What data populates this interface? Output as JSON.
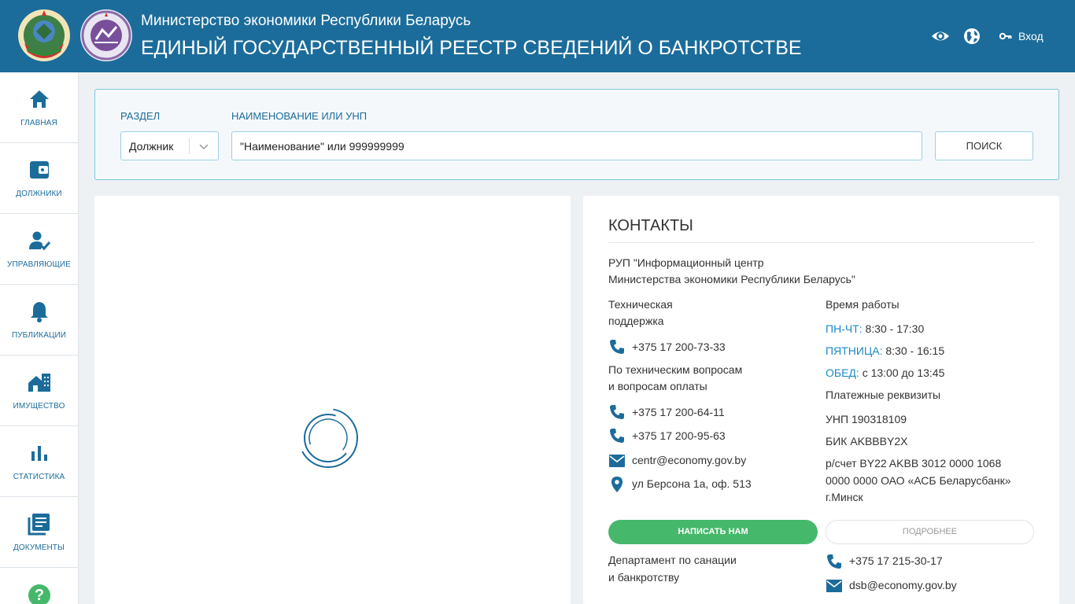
{
  "header": {
    "ministry": "Министерство экономики Республики Беларусь",
    "title": "ЕДИНЫЙ ГОСУДАРСТВЕННЫЙ РЕЕСТР СВЕДЕНИЙ О БАНКРОТСТВЕ",
    "login": "Вход"
  },
  "sidebar": {
    "items": [
      {
        "label": "ГЛАВНАЯ",
        "icon": "home-icon"
      },
      {
        "label": "ДОЛЖНИКИ",
        "icon": "wallet-icon"
      },
      {
        "label": "УПРАВЛЯЮЩИЕ",
        "icon": "user-check-icon"
      },
      {
        "label": "ПУБЛИКАЦИИ",
        "icon": "bell-icon"
      },
      {
        "label": "ИМУЩЕСТВО",
        "icon": "property-icon"
      },
      {
        "label": "СТАТИСТИКА",
        "icon": "bar-chart-icon"
      },
      {
        "label": "ДОКУМЕНТЫ",
        "icon": "documents-icon"
      }
    ],
    "help": "?"
  },
  "search": {
    "section_label": "РАЗДЕЛ",
    "section_value": "Должник",
    "name_label": "НАИМЕНОВАНИЕ ИЛИ УНП",
    "placeholder": "\"Наименование\" или 999999999",
    "button": "ПОИСК"
  },
  "contacts": {
    "title": "КОНТАКТЫ",
    "org_line1": "РУП \"Информационный центр",
    "org_line2": "Министерства экономики Республики Беларусь\"",
    "support_line1": "Техническая",
    "support_line2": "поддержка",
    "support_phone": "+375 17 200-73-33",
    "tech_line1": "По техническим вопросам",
    "tech_line2": "и вопросам оплаты",
    "tech_phone1": "+375 17 200-64-11",
    "tech_phone2": "+375 17 200-95-63",
    "email": "centr@economy.gov.by",
    "address": "ул Берсона 1а, оф. 513",
    "hours_title": "Время работы",
    "mon_thu_label": "ПН-ЧТ:",
    "mon_thu_value": "8:30 - 17:30",
    "fri_label": "ПЯТНИЦА:",
    "fri_value": "8:30 - 16:15",
    "lunch_label": "ОБЕД:",
    "lunch_value": "с 13:00 до 13:45",
    "payment_title": "Платежные реквизиты",
    "unp": "УНП 190318109",
    "bik": "БИК AKBBBY2X",
    "account_line1": "р/счет BY22 AKBB 3012 0000 1068",
    "account_line2": "0000 0000 ОАО «АСБ Беларусбанк»",
    "account_line3": "г.Минск",
    "write_button": "НАПИСАТЬ НАМ",
    "more_button": "ПОДРОБНЕЕ",
    "dept_line1": "Департамент по санации",
    "dept_line2": "и банкротству",
    "dept_phone": "+375 17 215-30-17",
    "dept_email": "dsb@economy.gov.by"
  },
  "colors": {
    "header": "#1b6c9a",
    "accent": "#1b8ac5",
    "green": "#46b86b"
  }
}
